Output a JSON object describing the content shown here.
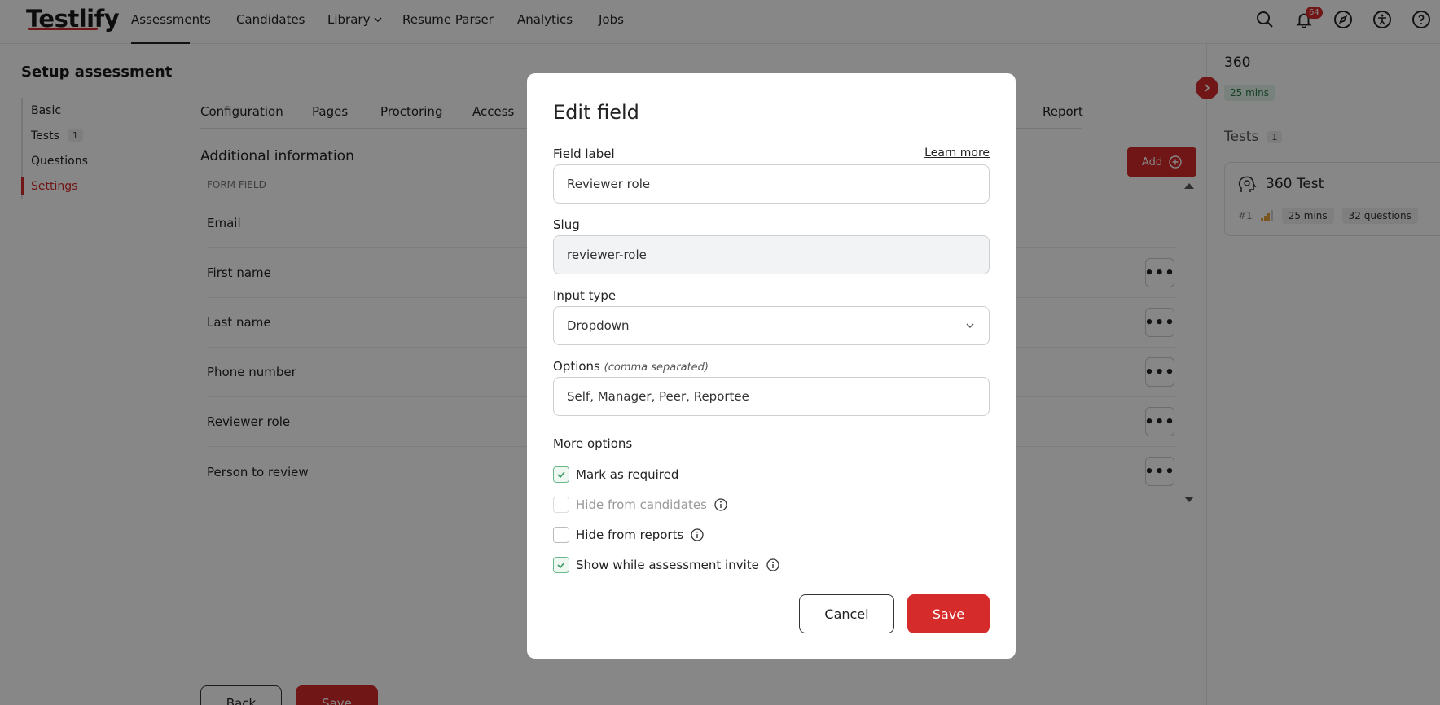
{
  "brand": {
    "logo": "Testlify",
    "accent": "#d62b2b"
  },
  "topnav": {
    "items": [
      {
        "label": "Assessments"
      },
      {
        "label": "Candidates"
      },
      {
        "label": "Library"
      },
      {
        "label": "Resume Parser"
      },
      {
        "label": "Analytics"
      },
      {
        "label": "Jobs"
      }
    ],
    "active": "Assessments",
    "notification_count": "64",
    "icons": [
      "search-icon",
      "bell-icon",
      "compass-icon",
      "accessibility-icon",
      "help-icon"
    ]
  },
  "page": {
    "title": "Setup assessment",
    "left_nav": [
      {
        "label": "Basic"
      },
      {
        "label": "Tests",
        "count": "1"
      },
      {
        "label": "Questions"
      },
      {
        "label": "Settings",
        "active": true
      }
    ],
    "tabs": [
      {
        "label": "Configuration"
      },
      {
        "label": "Pages"
      },
      {
        "label": "Proctoring"
      },
      {
        "label": "Access"
      },
      {
        "label": "Report"
      }
    ],
    "section_title": "Additional information",
    "column_header": "FORM FIELD",
    "add_label": "Add",
    "fields": [
      {
        "label": "Email"
      },
      {
        "label": "First name"
      },
      {
        "label": "Last name"
      },
      {
        "label": "Phone number"
      },
      {
        "label": "Reviewer role"
      },
      {
        "label": "Person to review"
      }
    ],
    "back_label": "Back",
    "save_label": "Save"
  },
  "right_panel": {
    "title": "360",
    "duration": "25 mins",
    "tests_label": "Tests",
    "tests_count": "1",
    "test_card": {
      "name": "360 Test",
      "index": "#1",
      "duration": "25 mins",
      "questions": "32 questions"
    }
  },
  "modal": {
    "title": "Edit field",
    "field_label_label": "Field label",
    "learn_more": "Learn more",
    "field_label_value": "Reviewer role",
    "slug_label": "Slug",
    "slug_value": "reviewer-role",
    "input_type_label": "Input type",
    "input_type_value": "Dropdown",
    "options_label": "Options",
    "options_hint": "(comma separated)",
    "options_value": "Self, Manager, Peer, Reportee",
    "more_options_label": "More options",
    "checkboxes": [
      {
        "label": "Mark as required",
        "checked": true
      },
      {
        "label": "Hide from candidates",
        "checked": false,
        "disabled": true
      },
      {
        "label": "Hide from reports",
        "checked": false
      },
      {
        "label": "Show while assessment invite",
        "checked": true
      }
    ],
    "cancel_label": "Cancel",
    "save_label": "Save"
  }
}
